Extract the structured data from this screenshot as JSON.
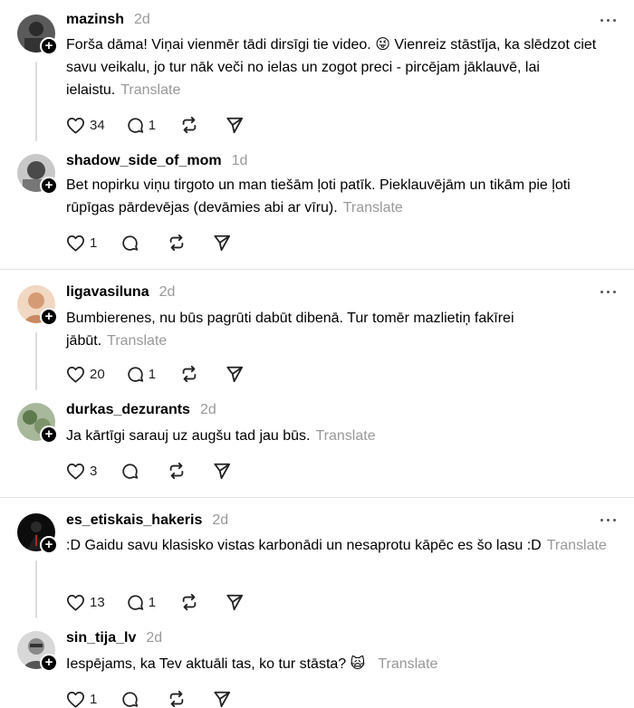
{
  "more_label": "...",
  "follow_symbol": "+",
  "posts": [
    {
      "username": "mazinsh",
      "time": "2d",
      "text": "Forša dāma! Viņai vienmēr tādi dirsīgi tie video. 😜 Vienreiz stāstīja, ka slēdzot ciet savu veikalu, jo tur nāk veči no ielas un zogot preci - pircējam jāklauvē, lai ielaistu.",
      "translate": "Translate",
      "likes": "34",
      "replies": "1",
      "avatar_color": "#4a4a4a"
    },
    {
      "username": "shadow_side_of_mom",
      "time": "1d",
      "text": "Bet nopirku viņu tirgoto un man tiešām ļoti patīk. Pieklauvējām un tikām pie ļoti rūpīgas pārdevējas (devāmies abi ar vīru).",
      "translate": "Translate",
      "likes": "1",
      "replies": "",
      "avatar_color": "#7a7a7a"
    },
    {
      "username": "ligavasiluna",
      "time": "2d",
      "text": "Bumbierenes, nu būs pagrūti dabūt dibenā. Tur tomēr mazlietiņ fakīrei jābūt.",
      "translate": "Translate",
      "likes": "20",
      "replies": "1",
      "avatar_color": "#d9a07a"
    },
    {
      "username": "durkas_dezurants",
      "time": "2d",
      "text": "Ja kārtīgi sarauj uz augšu tad jau būs.",
      "translate": "Translate",
      "likes": "3",
      "replies": "",
      "avatar_color": "#6f8f5f"
    },
    {
      "username": "es_etiskais_hakeris",
      "time": "2d",
      "text": ":D Gaidu savu klasisko vistas karbonādi un nesaprotu kāpēc es šo lasu :D",
      "translate": "Translate",
      "likes": "13",
      "replies": "1",
      "avatar_color": "#111111"
    },
    {
      "username": "sin_tija_lv",
      "time": "2d",
      "text": "Iespējams, ka Tev aktuāli tas, ko tur stāsta? 🙀",
      "translate": "Translate",
      "likes": "1",
      "replies": "",
      "avatar_color": "#9a9a9a"
    }
  ]
}
